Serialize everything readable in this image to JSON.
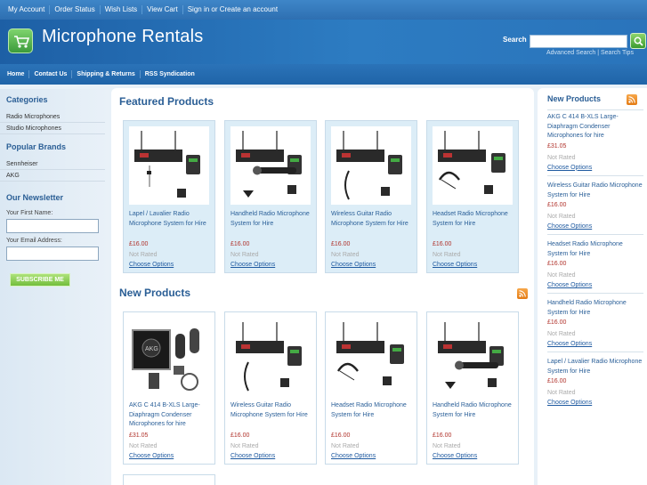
{
  "topbar": {
    "links": [
      "My Account",
      "Order Status",
      "Wish Lists",
      "View Cart",
      "Sign in or Create an account"
    ]
  },
  "header": {
    "title": "Microphone Rentals",
    "search_label": "Search",
    "search_value": "",
    "advanced_search": "Advanced Search",
    "search_tips": "Search Tips"
  },
  "nav": {
    "links": [
      "Home",
      "Contact Us",
      "Shipping & Returns",
      "RSS Syndication"
    ]
  },
  "sidebar": {
    "categories_heading": "Categories",
    "categories": [
      "Radio Microphones",
      "Studio Microphones"
    ],
    "brands_heading": "Popular Brands",
    "brands": [
      "Sennheiser",
      "AKG"
    ],
    "newsletter_heading": "Our Newsletter",
    "first_name_label": "Your First Name:",
    "email_label": "Your Email Address:",
    "subscribe_label": "SUBSCRIBE ME"
  },
  "featured": {
    "heading": "Featured Products",
    "products": [
      {
        "name": "Lapel / Lavalier Radio Microphone System for Hire",
        "price": "£16.00",
        "rating": "Not Rated",
        "option": "Choose Options",
        "image": "lapel-kit"
      },
      {
        "name": "Handheld Radio Microphone System for Hire",
        "price": "£16.00",
        "rating": "Not Rated",
        "option": "Choose Options",
        "image": "handheld-kit"
      },
      {
        "name": "Wireless Guitar Radio Microphone System for Hire",
        "price": "£16.00",
        "rating": "Not Rated",
        "option": "Choose Options",
        "image": "guitar-kit"
      },
      {
        "name": "Headset Radio Microphone System for Hire",
        "price": "£16.00",
        "rating": "Not Rated",
        "option": "Choose Options",
        "image": "headset-kit"
      }
    ]
  },
  "new_products": {
    "heading": "New Products",
    "products": [
      {
        "name": "AKG C 414 B-XLS Large-Diaphragm Condenser Microphones for hire",
        "price": "£31.05",
        "rating": "Not Rated",
        "option": "Choose Options",
        "image": "akg-case"
      },
      {
        "name": "Wireless Guitar Radio Microphone System for Hire",
        "price": "£16.00",
        "rating": "Not Rated",
        "option": "Choose Options",
        "image": "guitar-kit"
      },
      {
        "name": "Headset Radio Microphone System for Hire",
        "price": "£16.00",
        "rating": "Not Rated",
        "option": "Choose Options",
        "image": "headset-kit"
      },
      {
        "name": "Handheld Radio Microphone System for Hire",
        "price": "£16.00",
        "rating": "Not Rated",
        "option": "Choose Options",
        "image": "handheld-kit"
      }
    ]
  },
  "right_sidebar": {
    "heading": "New Products",
    "items": [
      {
        "name": "AKG C 414 B-XLS Large-Diaphragm Condenser Microphones for hire",
        "price": "£31.05",
        "rating": "Not Rated",
        "option": "Choose Options"
      },
      {
        "name": "Wireless Guitar Radio Microphone System for Hire",
        "price": "£16.00",
        "rating": "Not Rated",
        "option": "Choose Options"
      },
      {
        "name": "Headset Radio Microphone System for Hire",
        "price": "£16.00",
        "rating": "Not Rated",
        "option": "Choose Options"
      },
      {
        "name": "Handheld Radio Microphone System for Hire",
        "price": "£16.00",
        "rating": "Not Rated",
        "option": "Choose Options"
      },
      {
        "name": "Lapel / Lavalier Radio Microphone System for Hire",
        "price": "£16.00",
        "rating": "Not Rated",
        "option": "Choose Options"
      }
    ]
  },
  "colors": {
    "brand_blue": "#2a74bb",
    "heading_blue": "#2a5e95",
    "price_red": "#b0322b",
    "accent_green": "#73be3d",
    "rss_orange": "#e47b14"
  }
}
